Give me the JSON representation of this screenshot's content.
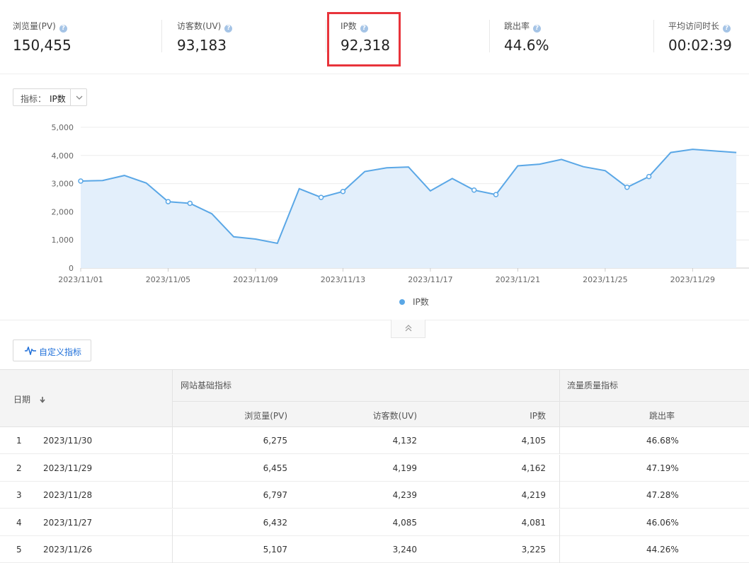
{
  "metrics": [
    {
      "label": "浏览量(PV)",
      "value": "150,455"
    },
    {
      "label": "访客数(UV)",
      "value": "93,183"
    },
    {
      "label": "IP数",
      "value": "92,318"
    },
    {
      "label": "跳出率",
      "value": "44.6%"
    },
    {
      "label": "平均访问时长",
      "value": "00:02:39"
    }
  ],
  "help_icon_glyph": "?",
  "selector": {
    "label": "指标：",
    "value": "IP数"
  },
  "chart_data": {
    "type": "area",
    "series": [
      {
        "name": "IP数",
        "color": "#5aa7e6",
        "values": [
          3090,
          3110,
          3290,
          3020,
          2360,
          2300,
          1930,
          1110,
          1030,
          880,
          2820,
          2510,
          2720,
          3430,
          3560,
          3590,
          2740,
          3180,
          2770,
          2610,
          3630,
          3690,
          3860,
          3600,
          3460,
          2870,
          3250,
          4105,
          4219,
          4162,
          4105
        ]
      }
    ],
    "x": [
      "2023/11/01",
      "2023/11/02",
      "2023/11/03",
      "2023/11/04",
      "2023/11/05",
      "2023/11/06",
      "2023/11/07",
      "2023/11/08",
      "2023/11/09",
      "2023/11/10",
      "2023/11/11",
      "2023/11/12",
      "2023/11/13",
      "2023/11/14",
      "2023/11/15",
      "2023/11/16",
      "2023/11/17",
      "2023/11/18",
      "2023/11/19",
      "2023/11/20",
      "2023/11/21",
      "2023/11/22",
      "2023/11/23",
      "2023/11/24",
      "2023/11/25",
      "2023/11/26",
      "2023/11/27",
      "2023/11/28",
      "2023/11/29",
      "2023/11/30",
      "2023/12/01"
    ],
    "marker_indices": [
      0,
      4,
      5,
      11,
      12,
      18,
      19,
      25,
      26
    ],
    "x_tick_labels": [
      "2023/11/01",
      "2023/11/05",
      "2023/11/09",
      "2023/11/13",
      "2023/11/17",
      "2023/11/21",
      "2023/11/25",
      "2023/11/29"
    ],
    "y_ticks": [
      "0",
      "1,000",
      "2,000",
      "3,000",
      "4,000",
      "5,000"
    ],
    "ylim": [
      0,
      5000
    ],
    "grid": true,
    "legend": "bottom-center"
  },
  "collapse_icon": "double-chevron-up",
  "custom_button": {
    "label": "自定义指标"
  },
  "table": {
    "date_header": "日期",
    "group1": "网站基础指标",
    "group2": "流量质量指标",
    "col_pv": "浏览量(PV)",
    "col_uv": "访客数(UV)",
    "col_ip": "IP数",
    "col_bounce": "跳出率",
    "rows": [
      {
        "idx": "1",
        "date": "2023/11/30",
        "pv": "6,275",
        "uv": "4,132",
        "ip": "4,105",
        "bounce": "46.68%"
      },
      {
        "idx": "2",
        "date": "2023/11/29",
        "pv": "6,455",
        "uv": "4,199",
        "ip": "4,162",
        "bounce": "47.19%"
      },
      {
        "idx": "3",
        "date": "2023/11/28",
        "pv": "6,797",
        "uv": "4,239",
        "ip": "4,219",
        "bounce": "47.28%"
      },
      {
        "idx": "4",
        "date": "2023/11/27",
        "pv": "6,432",
        "uv": "4,085",
        "ip": "4,081",
        "bounce": "46.06%"
      },
      {
        "idx": "5",
        "date": "2023/11/26",
        "pv": "5,107",
        "uv": "3,240",
        "ip": "3,225",
        "bounce": "44.26%"
      }
    ]
  }
}
